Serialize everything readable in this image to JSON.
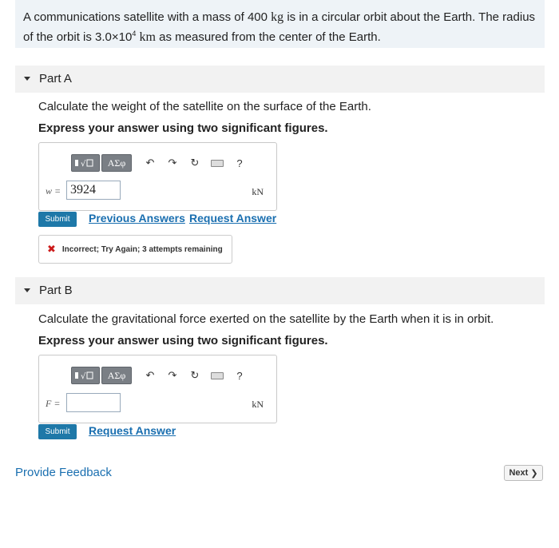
{
  "problem": {
    "text_1": "A communications satellite with a mass of 400 ",
    "mass_unit": "kg",
    "text_2": " is in a circular orbit about the Earth. The radius of the orbit is 3.0×10",
    "exponent": "4",
    "text_3": " ",
    "radius_unit": "km",
    "text_4": " as measured from the center of the Earth."
  },
  "part_a": {
    "title": "Part A",
    "question": "Calculate the weight of the satellite on the surface of the Earth.",
    "instruction": "Express your answer using two significant figures.",
    "toolbar": {
      "greek": "ΑΣφ",
      "help": "?"
    },
    "variable": "w =",
    "answer_value": "3924",
    "unit": "kN",
    "submit_label": "Submit",
    "previous_answers_label": "Previous Answers",
    "request_answer_label": "Request Answer",
    "feedback": "Incorrect; Try Again; 3 attempts remaining"
  },
  "part_b": {
    "title": "Part B",
    "question": "Calculate the gravitational force exerted on the satellite by the Earth when it is in orbit.",
    "instruction": "Express your answer using two significant figures.",
    "toolbar": {
      "greek": "ΑΣφ",
      "help": "?"
    },
    "variable": "F =",
    "answer_value": "",
    "unit": "kN",
    "submit_label": "Submit",
    "request_answer_label": "Request Answer"
  },
  "footer": {
    "provide_feedback": "Provide Feedback",
    "next_label": "Next"
  }
}
